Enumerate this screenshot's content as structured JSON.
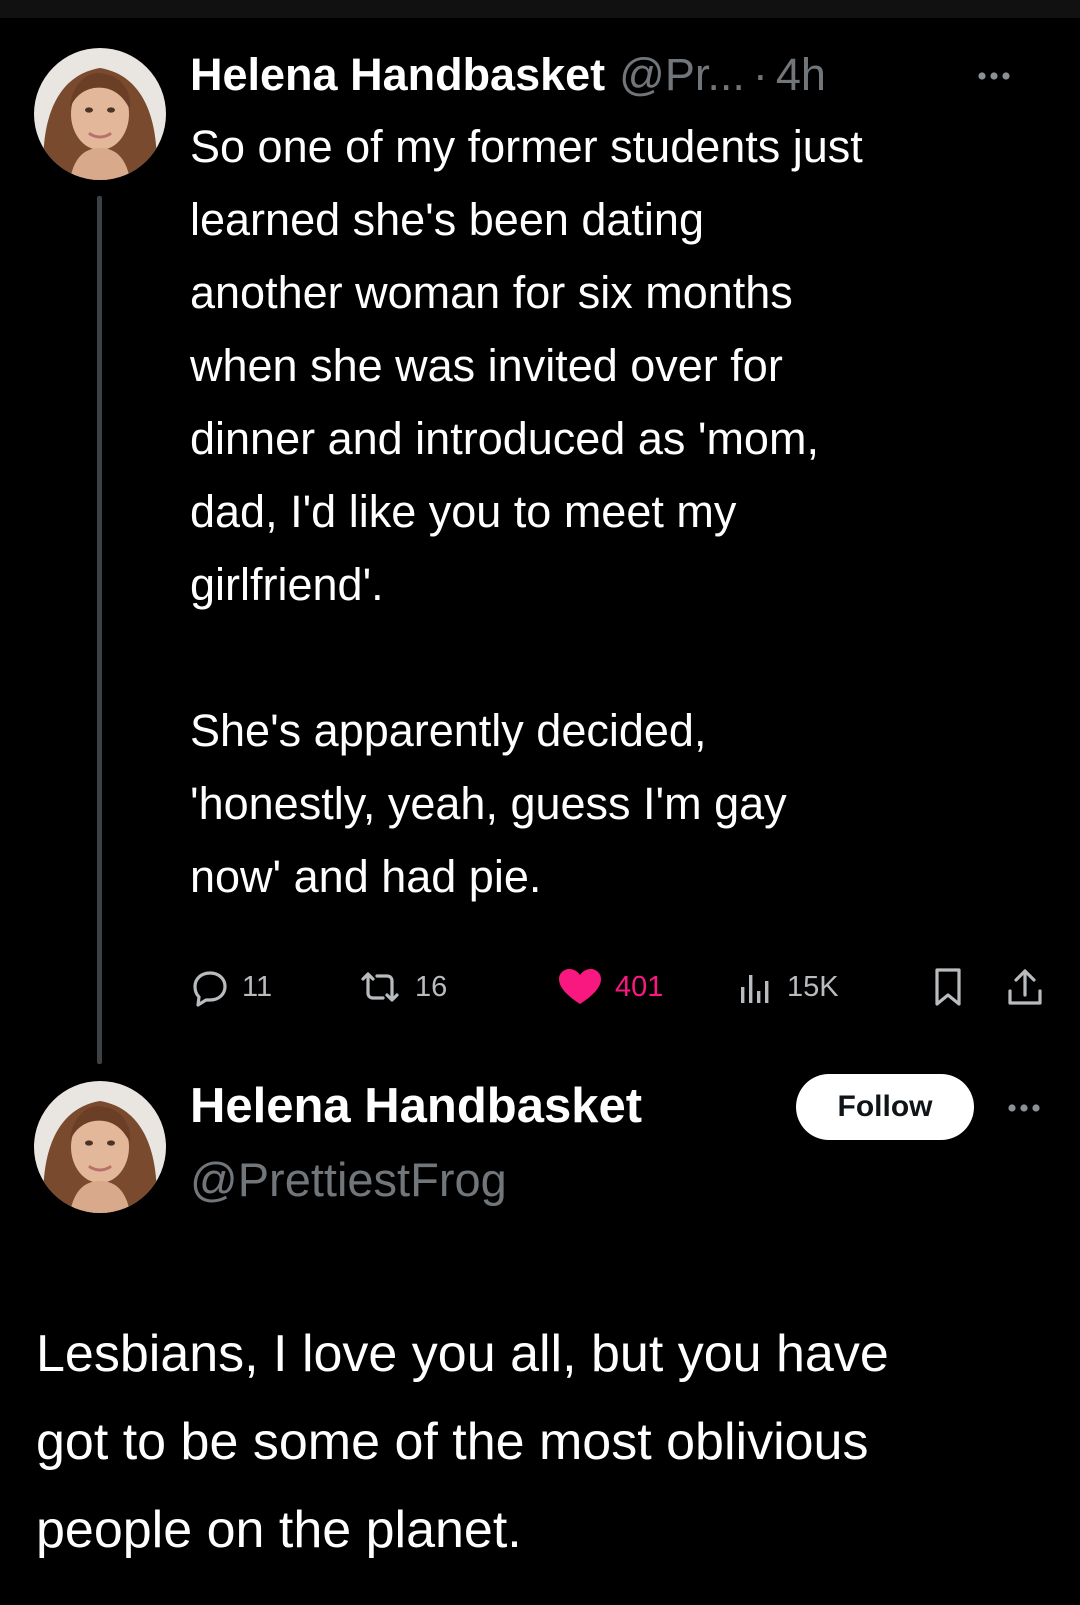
{
  "tweet": {
    "author": {
      "display_name": "Helena Handbasket",
      "handle_truncated": "@Pr...",
      "separator": "·",
      "timestamp": "4h"
    },
    "body_lines": [
      "So one of my former students just",
      "learned she's been dating",
      "another woman for six months",
      "when she was invited over for",
      "dinner and introduced as 'mom,",
      "dad, I'd like you to meet my",
      "girlfriend'.",
      "",
      "She's apparently decided,",
      "'honestly, yeah, guess I'm gay",
      "now' and had pie."
    ],
    "stats": {
      "replies": "11",
      "reposts": "16",
      "likes": "401",
      "views": "15K"
    },
    "icons": {
      "more": "more-icon",
      "reply": "reply-icon",
      "repost": "repost-icon",
      "like": "heart-icon",
      "views": "views-icon",
      "bookmark": "bookmark-icon",
      "share": "share-icon"
    }
  },
  "post": {
    "author": {
      "display_name": "Helena Handbasket",
      "handle": "@PrettiestFrog"
    },
    "follow_label": "Follow",
    "body_lines": [
      "Lesbians, I love you all, but you have",
      "got to be some of the most oblivious",
      "people on the planet."
    ]
  },
  "colors": {
    "background": "#000000",
    "text": "#ffffff",
    "muted": "#71767b",
    "like_accent": "#f91880",
    "thread_line": "#3e4144"
  }
}
